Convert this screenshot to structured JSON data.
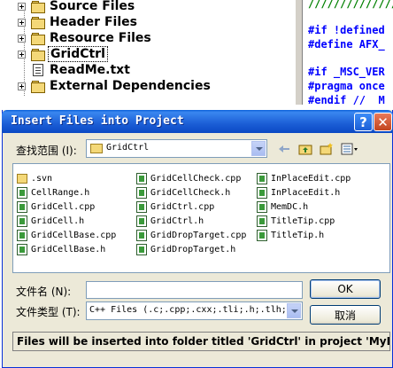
{
  "workspace_tree": {
    "items": [
      {
        "label": "Source Files",
        "type": "folder",
        "expandable": true
      },
      {
        "label": "Header Files",
        "type": "folder",
        "expandable": true
      },
      {
        "label": "Resource Files",
        "type": "folder",
        "expandable": true
      },
      {
        "label": "GridCtrl",
        "type": "folder",
        "expandable": true,
        "selected": true
      },
      {
        "label": "ReadMe.txt",
        "type": "file",
        "expandable": false
      },
      {
        "label": "External Dependencies",
        "type": "folder",
        "expandable": true
      }
    ]
  },
  "code_editor": {
    "lines": [
      {
        "text": "////////////////",
        "style": "comment"
      },
      {
        "text": "#if !defined",
        "style": "keyword"
      },
      {
        "text": "#define AFX_",
        "style": "keyword"
      },
      {
        "text": "#if _MSC_VER",
        "style": "keyword"
      },
      {
        "text": "#pragma once",
        "style": "keyword"
      },
      {
        "text": "#endif // _M",
        "style": "keyword"
      }
    ]
  },
  "dialog": {
    "title": "Insert Files into Project",
    "help_label": "?",
    "close_label": "✕",
    "look_in_label": "查找范围 (I):",
    "look_in_value": "GridCtrl",
    "toolbar_icons": [
      "back-arrow-icon",
      "up-folder-icon",
      "new-folder-icon",
      "view-menu-icon"
    ],
    "files": [
      {
        "name": ".svn",
        "kind": "folder"
      },
      {
        "name": "CellRange.h",
        "kind": "source"
      },
      {
        "name": "GridCell.cpp",
        "kind": "source"
      },
      {
        "name": "GridCell.h",
        "kind": "source"
      },
      {
        "name": "GridCellBase.cpp",
        "kind": "source"
      },
      {
        "name": "GridCellBase.h",
        "kind": "source"
      },
      {
        "name": "GridCellCheck.cpp",
        "kind": "source"
      },
      {
        "name": "GridCellCheck.h",
        "kind": "source"
      },
      {
        "name": "GridCtrl.cpp",
        "kind": "source"
      },
      {
        "name": "GridCtrl.h",
        "kind": "source"
      },
      {
        "name": "GridDropTarget.cpp",
        "kind": "source"
      },
      {
        "name": "GridDropTarget.h",
        "kind": "source"
      },
      {
        "name": "InPlaceEdit.cpp",
        "kind": "source"
      },
      {
        "name": "InPlaceEdit.h",
        "kind": "source"
      },
      {
        "name": "MemDC.h",
        "kind": "source"
      },
      {
        "name": "TitleTip.cpp",
        "kind": "source"
      },
      {
        "name": "TitleTip.h",
        "kind": "source"
      }
    ],
    "filename_label": "文件名 (N):",
    "filename_value": "",
    "filetype_label": "文件类型 (T):",
    "filetype_value": "C++ Files (.c;.cpp;.cxx;.tli;.h;.tlh;",
    "ok_label": "OK",
    "cancel_label": "取消",
    "status_text": "Files will be inserted into folder titled 'GridCtrl' in project 'MyRl"
  },
  "colors": {
    "titlebar": "#1b5ed6",
    "dialog_bg": "#ece9d8",
    "keyword": "#0000ff",
    "comment": "#008000"
  }
}
